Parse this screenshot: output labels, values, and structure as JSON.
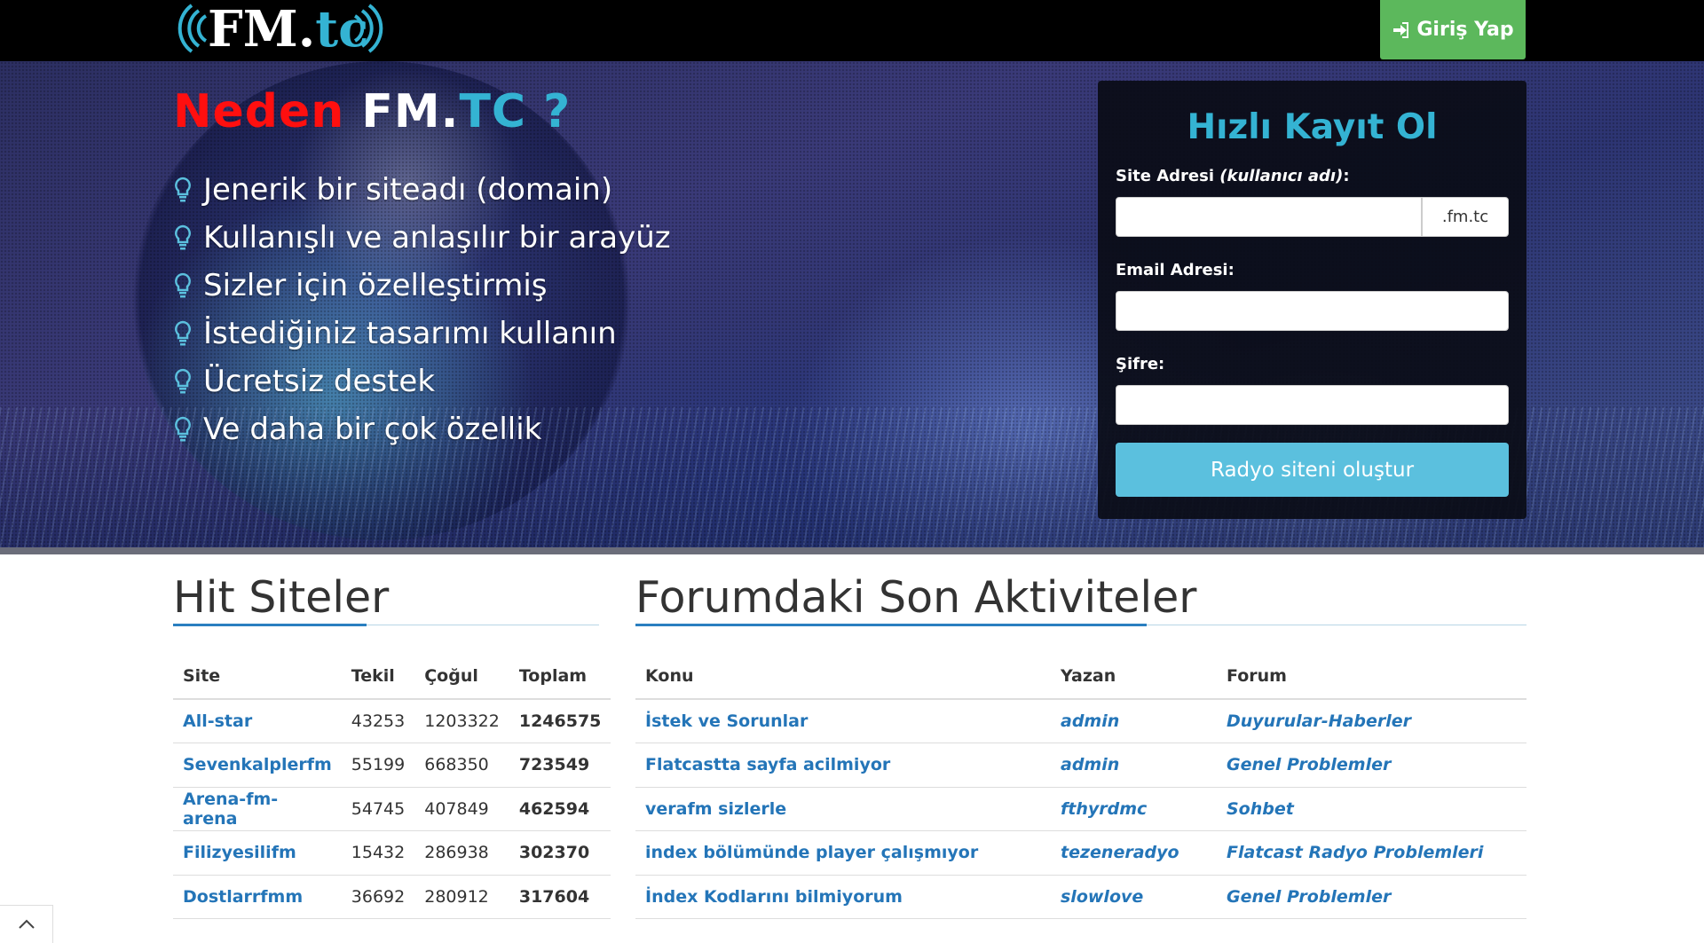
{
  "header": {
    "logo_text": "FM.tc",
    "login_label": "Giriş Yap"
  },
  "hero": {
    "headline_part1": "Neden",
    "headline_part2": "FM.",
    "headline_part3": "TC ?",
    "features": [
      "Jenerik bir siteadı (domain)",
      "Kullanışlı ve anlaşılır bir arayüz",
      "Sizler için özelleştirmiş",
      "İstediğiniz tasarımı kullanın",
      "Ücretsiz destek",
      "Ve daha bir çok özellik"
    ]
  },
  "register": {
    "title": "Hızlı Kayıt Ol",
    "site_label": "Site Adresi",
    "site_label_hint": "(kullanıcı adı)",
    "site_label_colon": ":",
    "site_suffix": ".fm.tc",
    "email_label": "Email Adresi:",
    "password_label": "Şifre:",
    "submit_label": "Radyo siteni oluştur"
  },
  "hit_sites": {
    "title": "Hit Siteler",
    "columns": [
      "Site",
      "Tekil",
      "Çoğul",
      "Toplam"
    ],
    "rows": [
      {
        "site": "All-star",
        "tekil": "43253",
        "cogul": "1203322",
        "toplam": "1246575"
      },
      {
        "site": "Sevenkalplerfm",
        "tekil": "55199",
        "cogul": "668350",
        "toplam": "723549"
      },
      {
        "site": "Arena-fm-arena",
        "tekil": "54745",
        "cogul": "407849",
        "toplam": "462594"
      },
      {
        "site": "Filizyesilifm",
        "tekil": "15432",
        "cogul": "286938",
        "toplam": "302370"
      },
      {
        "site": "Dostlarrfmm",
        "tekil": "36692",
        "cogul": "280912",
        "toplam": "317604"
      }
    ]
  },
  "forum": {
    "title": "Forumdaki Son Aktiviteler",
    "columns": [
      "Konu",
      "Yazan",
      "Forum"
    ],
    "rows": [
      {
        "konu": "İstek ve Sorunlar",
        "yazan": "admin",
        "forum": "Duyurular-Haberler"
      },
      {
        "konu": "Flatcastta sayfa acilmiyor",
        "yazan": "admin",
        "forum": "Genel Problemler"
      },
      {
        "konu": "verafm sizlerle",
        "yazan": "fthyrdmc",
        "forum": "Sohbet"
      },
      {
        "konu": "index bölümünde player çalışmıyor",
        "yazan": "tezeneradyo",
        "forum": "Flatcast Radyo Problemleri"
      },
      {
        "konu": "İndex Kodlarını bilmiyorum",
        "yazan": "slowlove",
        "forum": "Genel Problemler"
      }
    ]
  },
  "colors": {
    "accent": "#34b3d3",
    "link": "#2475b8",
    "login_green": "#5cb85c",
    "headline_red": "#ff0f0f"
  }
}
